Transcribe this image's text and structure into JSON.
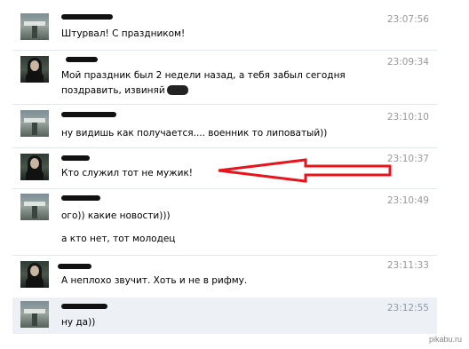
{
  "messages": [
    {
      "sender": "male",
      "time": "23:07:56",
      "lines": [
        "Штурвал! С праздником!"
      ]
    },
    {
      "sender": "female",
      "time": "23:09:34",
      "lines": [
        "Мой праздник был 2 недели назад, а тебя забыл сегодня",
        "поздравить, извиняй"
      ]
    },
    {
      "sender": "male",
      "time": "23:10:10",
      "lines": [
        "ну видишь как получается.... военник то липоватый))"
      ]
    },
    {
      "sender": "female",
      "time": "23:10:37",
      "lines": [
        "Кто служил тот не мужик!"
      ]
    },
    {
      "sender": "male",
      "time": "23:10:49",
      "lines": [
        "ого)) какие новости)))",
        "а кто нет, тот молодец"
      ]
    },
    {
      "sender": "female",
      "time": "23:11:33",
      "lines": [
        "А неплохо звучит. Хоть и не в рифму."
      ]
    },
    {
      "sender": "male",
      "time": "23:12:55",
      "lines": [
        "ну да))"
      ]
    }
  ],
  "annotation": {
    "color": "#e8141b",
    "icon": "red-arrow-icon"
  },
  "watermark": "pikabu.ru"
}
